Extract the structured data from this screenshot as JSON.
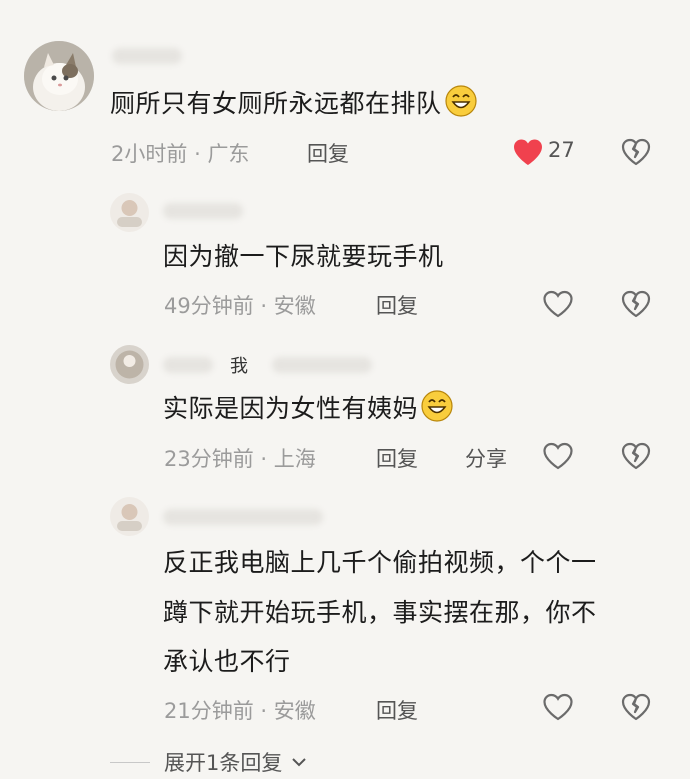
{
  "comments": [
    {
      "text": "厕所只有女厕所永远都在排队",
      "time": "2小时前",
      "location": "广东",
      "reply_label": "回复",
      "like_count": "27"
    },
    {
      "text": "因为撤一下尿就要玩手机",
      "time": "49分钟前",
      "location": "安徽",
      "reply_label": "回复"
    },
    {
      "author_tag": "我",
      "text": "实际是因为女性有姨妈",
      "time": "23分钟前",
      "location": "上海",
      "reply_label": "回复",
      "share_label": "分享"
    },
    {
      "text_lines": [
        "反正我电脑上几千个偷拍视频，个个一",
        "蹲下就开始玩手机，事实摆在那，你不",
        "承认也不行"
      ],
      "time": "21分钟前",
      "location": "安徽",
      "reply_label": "回复"
    }
  ],
  "expand_label": "展开1条回复",
  "meta_separator": "·",
  "colors": {
    "like_red": "#f0414e",
    "meta_gray": "#9b9b9b",
    "icon_gray": "#6b6b6b"
  }
}
